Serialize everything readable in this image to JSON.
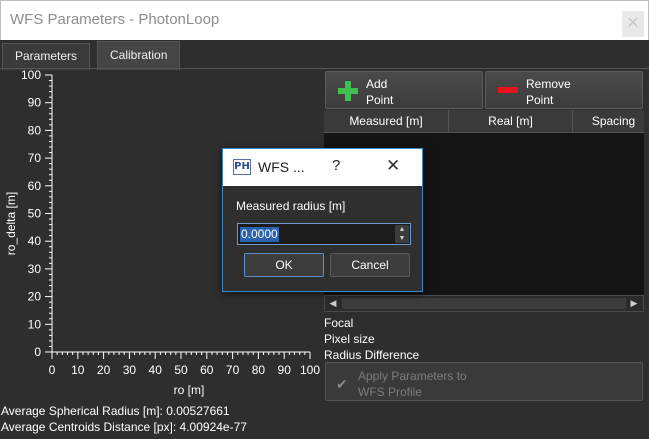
{
  "window": {
    "title": "WFS Parameters - PhotonLoop",
    "close_glyph": "✕"
  },
  "tabs": [
    {
      "label": "Parameters",
      "active": false
    },
    {
      "label": "Calibration",
      "active": true
    }
  ],
  "chart_data": {
    "type": "scatter",
    "x": [],
    "y": [],
    "xlabel": "ro [m]",
    "ylabel": "ro_delta [m]",
    "xlim": [
      0,
      100
    ],
    "ylim": [
      0,
      100
    ],
    "x_ticks": [
      "0",
      "10",
      "20",
      "30",
      "40",
      "50",
      "60",
      "70",
      "80",
      "90",
      "100"
    ],
    "y_ticks": [
      "0",
      "10",
      "20",
      "30",
      "40",
      "50",
      "60",
      "70",
      "80",
      "90",
      "100"
    ],
    "grid": false
  },
  "toolbar": {
    "add_label": "Add\nPoint",
    "add_icon": "plus-icon",
    "remove_label": "Remove\nPoint",
    "remove_icon": "minus-icon",
    "add_color": "#3fbf4f",
    "remove_color": "#e8141c"
  },
  "table": {
    "columns": [
      "Measured [m]",
      "Real [m]",
      "Spacing"
    ],
    "rows": []
  },
  "info": {
    "focal": "Focal",
    "pixel_size": "Pixel size",
    "radius_difference": "Radius Difference"
  },
  "apply_button": {
    "label": "Apply Parameters to\nWFS Profile",
    "enabled": false
  },
  "status": {
    "avg_radius": "Average Spherical Radius [m]: 0.00527661",
    "avg_distance": "Average Centroids Distance [px]: 4.00924e-77"
  },
  "dialog": {
    "title": "WFS ...",
    "icon_text": "PH",
    "help_glyph": "?",
    "close_glyph": "✕",
    "prompt": "Measured radius [m]",
    "value": "0.0000",
    "ok_label": "OK",
    "cancel_label": "Cancel"
  }
}
